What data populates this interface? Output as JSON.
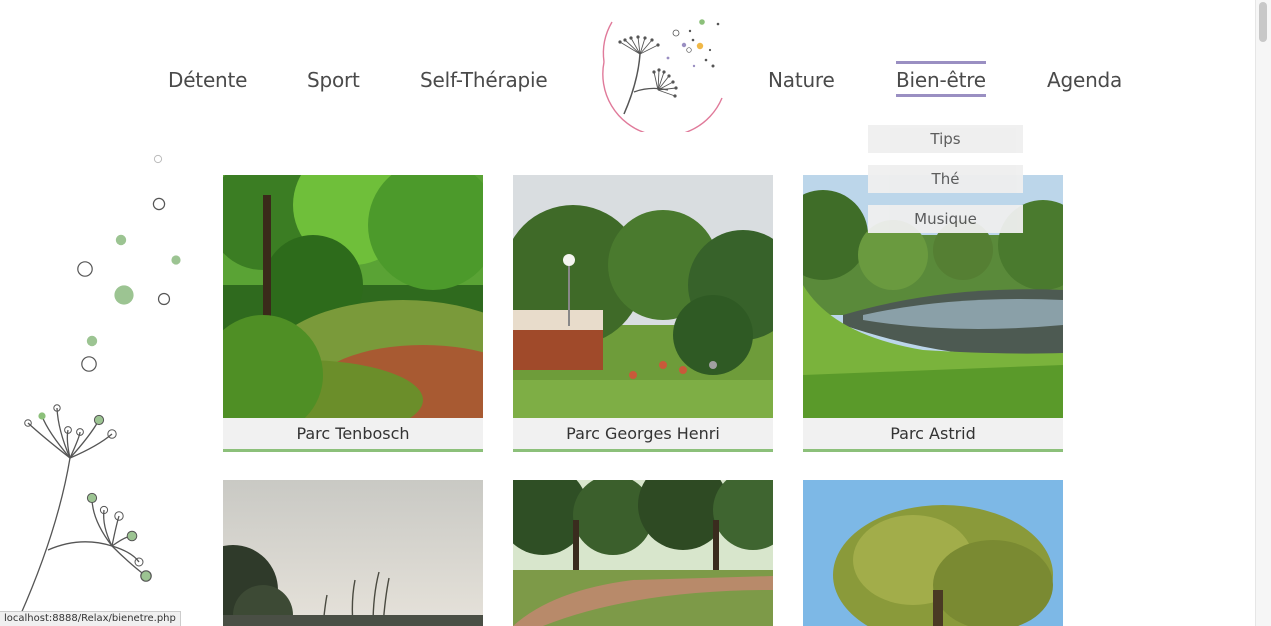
{
  "nav": {
    "items": [
      {
        "label": "Détente"
      },
      {
        "label": "Sport"
      },
      {
        "label": "Self-Thérapie"
      },
      {
        "label": "Nature"
      },
      {
        "label": "Bien-être"
      },
      {
        "label": "Agenda"
      }
    ],
    "active": "Bien-être"
  },
  "dropdown": {
    "items": [
      "Tips",
      "Thé",
      "Musique"
    ]
  },
  "parks": [
    {
      "name": "Parc Tenbosch"
    },
    {
      "name": "Parc Georges Henri"
    },
    {
      "name": "Parc Astrid"
    }
  ],
  "colors": {
    "accent_purple": "#9a8fc2",
    "accent_green": "#8cc07a",
    "logo_circle_pink": "#e07a9a"
  },
  "status_bar": {
    "text": "localhost:8888/Relax/bienetre.php"
  }
}
